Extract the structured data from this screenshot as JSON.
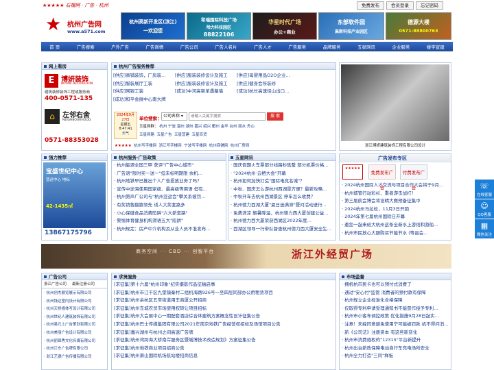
{
  "topbar": {
    "slogan": "★★★★★ 石榴网 · 广告 · 杭州",
    "buttons": [
      "免费发布",
      "会员登录",
      "忘记密码"
    ]
  },
  "logo": {
    "name": "杭州广告网",
    "url": "www.a571.com"
  },
  "ads_top": [
    {
      "label": "杭州高新开发区(滨江)",
      "sub": "一欢迎您"
    },
    {
      "label": "和瑞国际科技广场",
      "sub": "88822106",
      "sub2": "险力科技园区"
    },
    {
      "label": "华星时代广场",
      "sub": "办公+商业"
    },
    {
      "label": "东部软件园",
      "sub": "高新科技产业园区"
    },
    {
      "label": "德源大楼",
      "sub": "0571-88800763"
    }
  ],
  "nav": [
    "首  页",
    "广告搜索",
    "户外广告",
    "广告商情",
    "广告公司",
    "广告人名片",
    "广告人才",
    "广告服务",
    "品牌服务",
    "五星网讯",
    "企业服务",
    "楼宇宣建"
  ],
  "left1": {
    "title": "网上看房",
    "brand": "博妍装饰",
    "brand_en": "BOYAN DECORATION",
    "desc": "建筑装修装饰工程或服务商",
    "phone": "400-0571-135",
    "brand2": "左邻右舍",
    "brand2_en": "NEIGHBOURHOOD",
    "phone2": "0571-88353028"
  },
  "center1": {
    "title": "杭州广告服务推荐",
    "items": [
      [
        "[供应]商铺装饰，厂房装...",
        "[供应]服装展厅工装",
        "[供应]网银工装",
        "[成功]和平会展中心南大牌"
      ],
      [
        "[供应]服装装修设计及施工",
        "[供应]服装装修设计及施工",
        "[成功]中河高架单遇幕墙"
      ],
      [
        "[供应]母婴用品O2O企业...",
        "[供应]健身会所装修",
        "[成功]杭长高速径山出口..."
      ]
    ],
    "search_label": "单位搜索：",
    "date": "2024年9月27日",
    "weekday": "星期五",
    "time": "8:47:41",
    "weather": "天气",
    "select": "公司名称",
    "placeholder": "请输入关键字搜索",
    "search_btn": "搜 索",
    "regions_label": "五星网群：",
    "regions": [
      "杭州",
      "宁波",
      "温州",
      "湖州",
      "嘉兴",
      "绍兴",
      "衢州",
      "金华",
      "台州",
      "丽水",
      "舟山"
    ],
    "sub_links": [
      "五星网路",
      "五星广告",
      "五星营建",
      "五星百货"
    ],
    "rating": "★★★★★",
    "bottom_links": [
      "杭州写字楼网",
      "浙江写字楼网",
      "宁波写字楼网",
      "杭州商铺网",
      "杭州厂房网"
    ]
  },
  "right1": {
    "title": "杭州广告服务推荐",
    "caption": "浙江博妍建筑装饰工程有限公司设计"
  },
  "left2": {
    "title": "强力推荐",
    "brand": "宝盛世纪中心",
    "tag": "营运中心 地标",
    "area": "42-1435㎡",
    "phone": "13867175796"
  },
  "center2a": {
    "title": "杭州服务·广告政策",
    "items": [
      "杭州能源全国三甲 获评\"广告中心城市\"",
      "广告语\"限时买一送一\"但未标明期限 余机...",
      "杭州地铁早已推出个人广告投放业务了吗？",
      "宣传中途海使用国家级、最高级等用语 但有...",
      "杭州第声广公司与\"杭州亚运会\"攀关系被罚...",
      "有奖销售翻篇领先 诱人大奖套路多",
      "小心保健食品消费陷阱\"六大新套路\"",
      "警惕体育健身机构滑语五大\"陷阱\"",
      "杭州规定：房产中介机构及从业人员不准发布..."
    ]
  },
  "center2b": {
    "title": "五星网讯",
    "items": [
      "国庆假期火车票部分线路秒售罄 部分机票价格...",
      "\"2024杭州·云栖大会\"开幕",
      "杭州如何加快打造\"国际电竞名城\"？",
      "中秋、国庆怎么游杭州西湖景方便？最新攻略...",
      "中秋开车去杭州西湖景区 停车怎么收费？",
      "杭州德力西湖大厦\"夏日选满滞\"暨问活动进行...",
      "免费清凉 解暑降温，杭州德力西大厦创建公益...",
      "杭州德力西大厦荣获西湖区2022年度...",
      "西湖区领导一行带队督查杭州德力西大厦安全生..."
    ]
  },
  "right2": {
    "title": "广告发布专区",
    "buttons": [
      "免费发布广告",
      "付费发布广告"
    ],
    "items": [
      "2024杭州国际人才交流与项目合作大会将于9月...",
      "杭州城管行动彩衫、重者游击战打！",
      "第三届航会博会将设精大赛预备征集中",
      "2024杭州马拉松，11月3日开跑",
      "2024年第七届杭州国际日开幕",
      "邀您一起来给大杭州这条全新水上游线和游船...",
      "杭州市民放心大胆购买节能节水 (等县会..."
    ]
  },
  "banner": {
    "left_text": "商务空间 ··· CBD ··· 创智平台",
    "right_text": "浙江外经贸广场"
  },
  "left3": {
    "title": "广告公司",
    "tabs": [
      "浙江广告公司",
      "最新注册公司"
    ],
    "items": [
      "杭州创杰展览展示有限公司",
      "杭州钱达室内设计有限公司",
      "杭州天桥墙体写设计有限公司",
      "杭州世纪人建筑装饰有限公司",
      "杭州易元上广告策划有限公司",
      "杭州美丽广告设计有限公司",
      "杭州丽锦秀文化传媒有限公司",
      "杭州江东广告牌有限公司",
      "浙江艺德广告传播有限公司"
    ]
  },
  "center3": {
    "title": "求贤服务",
    "items": [
      "[求征集]第十六届\"杭州印象\"纪实摄影作品征稿启事",
      "[求征集]杭州市江干区九堡镇秦村二组机海路926号一至四层同部办公用租赁项目",
      "[求征集]杭州余杭区五常街道用丰商厦公开招商",
      "[求征集]杭州东城农贸市场使用权转让项目招标",
      "[求征集]杭州大会展中心一期配套酒店综合体建筑方案概念性设计征集公告",
      "[求征集]杭州巴士传媒集团有限公司2021年南京地铁广告经营权招标及场馆项目公告",
      "[求征集]嘉兴湖州与杭州之间高速广告牌",
      "[求征集]杭州湾跨海大桥南岸服务区暨城博技术改造规划》方案征集公告",
      "[求征集]杭州地铁商业项目招商公告",
      "[求征集]杭州萧山国际机场航站楼招商信息"
    ]
  },
  "right3": {
    "title": "市场监督",
    "items": [
      "拥机杭市民卡也可以预付式消费了",
      "通过\"安心付\"监管 消费者的预付款有保障",
      "杭州规立企业标准化合格保障",
      "仅取得专利申请受理通知书不能冒作授予专利...",
      "杭州市小客车调控政策 优化措施9月28日起实...",
      "注意！未经同意避免使用宁可能被罚款 机不得问消...",
      "新《公司法》注册资本 有这些新变化",
      "杭州市消费维权的\"12315\"平台新提升",
      "杭州出台新政保障电动自行车充电场所安全",
      "杭州全力打造\"三同\"样板"
    ]
  },
  "float": [
    {
      "icon": "headset-icon",
      "label": "在线客服"
    },
    {
      "icon": "qq-icon",
      "label": "QQ客服"
    },
    {
      "icon": "wechat-icon",
      "label": "微信关注"
    }
  ],
  "colors": {
    "brand_red": "#cc0000",
    "nav_blue": "#1d4a9a",
    "link_blue": "#1a3c8c"
  }
}
